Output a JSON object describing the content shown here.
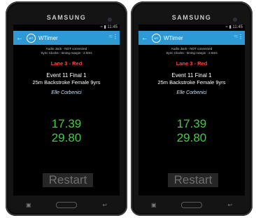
{
  "phones": [
    {
      "brand": "SAMSUNG",
      "status": "≈ ▮ 11:45",
      "app": {
        "title": "WTimer",
        "icon_text": "WT",
        "back_icon": "back-arrow-icon",
        "wifi_icon": "wifi-icon",
        "menu_icon": "overflow-menu-icon"
      },
      "info": {
        "line1": "Audio Jack - NOT connected",
        "line2": "Sync Clocks - timing margin : 2.6ms"
      },
      "lane": "Lane 3 - Red",
      "event": {
        "line1": "Event 11 Final 1",
        "line2": "25m Backstroke Female 9yrs"
      },
      "swimmer": "Elle Corbenici",
      "times": [
        "17.39",
        "29.80"
      ],
      "restart": "Restart"
    },
    {
      "brand": "SAMSUNG",
      "status": "≈ ▮ 11:45",
      "app": {
        "title": "WTimer",
        "icon_text": "WT",
        "back_icon": "back-arrow-icon",
        "wifi_icon": "wifi-icon",
        "menu_icon": "overflow-menu-icon"
      },
      "info": {
        "line1": "Audio Jack - NOT connected",
        "line2": "Sync Clocks - timing margin : 2.6ms"
      },
      "lane": "Lane 3 - Red",
      "event": {
        "line1": "Event 11 Final 1",
        "line2": "25m Backstroke Female 9yrs"
      },
      "swimmer": "Elle Corbenici",
      "times": [
        "17.39",
        "29.80"
      ],
      "restart": "Restart"
    }
  ],
  "colors": {
    "appbar": "#2d9ad6",
    "lane": "#ff4040",
    "time": "#3fcf3f"
  }
}
